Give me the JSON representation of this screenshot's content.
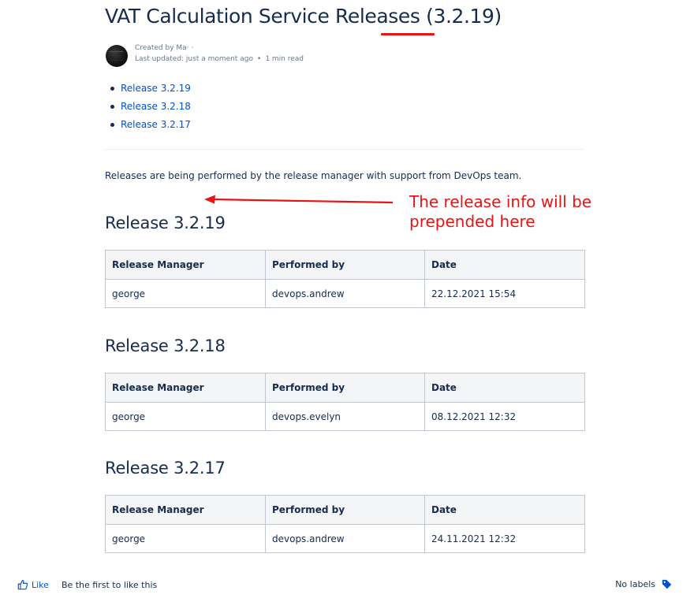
{
  "page": {
    "title": "VAT Calculation Service Releases (3.2.19)",
    "byline": {
      "created": "Created by Ma· ·",
      "last_updated": "Last updated: just a moment ago",
      "separator": "•",
      "read_time": "1 min read"
    }
  },
  "toc": [
    "Release 3.2.19",
    "Release 3.2.18",
    "Release 3.2.17"
  ],
  "intro": "Releases are being performed by the release manager with support from DevOps team.",
  "annotation": {
    "line1": "The release info will be",
    "line2": "prepended here",
    "color": "#e81414"
  },
  "table_headers": [
    "Release Manager",
    "Performed by",
    "Date"
  ],
  "releases": [
    {
      "heading": "Release 3.2.19",
      "row": [
        "george",
        "devops.andrew",
        "22.12.2021 15:54"
      ]
    },
    {
      "heading": "Release 3.2.18",
      "row": [
        "george",
        "devops.evelyn",
        "08.12.2021 12:32"
      ]
    },
    {
      "heading": "Release 3.2.17",
      "row": [
        "george",
        "devops.andrew",
        "24.11.2021 12:32"
      ]
    }
  ],
  "footer": {
    "like": "Like",
    "first_like": "Be the first to like this",
    "labels": "No labels"
  },
  "colors": {
    "link": "#0052cc",
    "text": "#172b4d",
    "annotation": "#e81414"
  },
  "icons": [
    "thumbs-up-icon",
    "tag-icon",
    "arrow-left-icon"
  ]
}
